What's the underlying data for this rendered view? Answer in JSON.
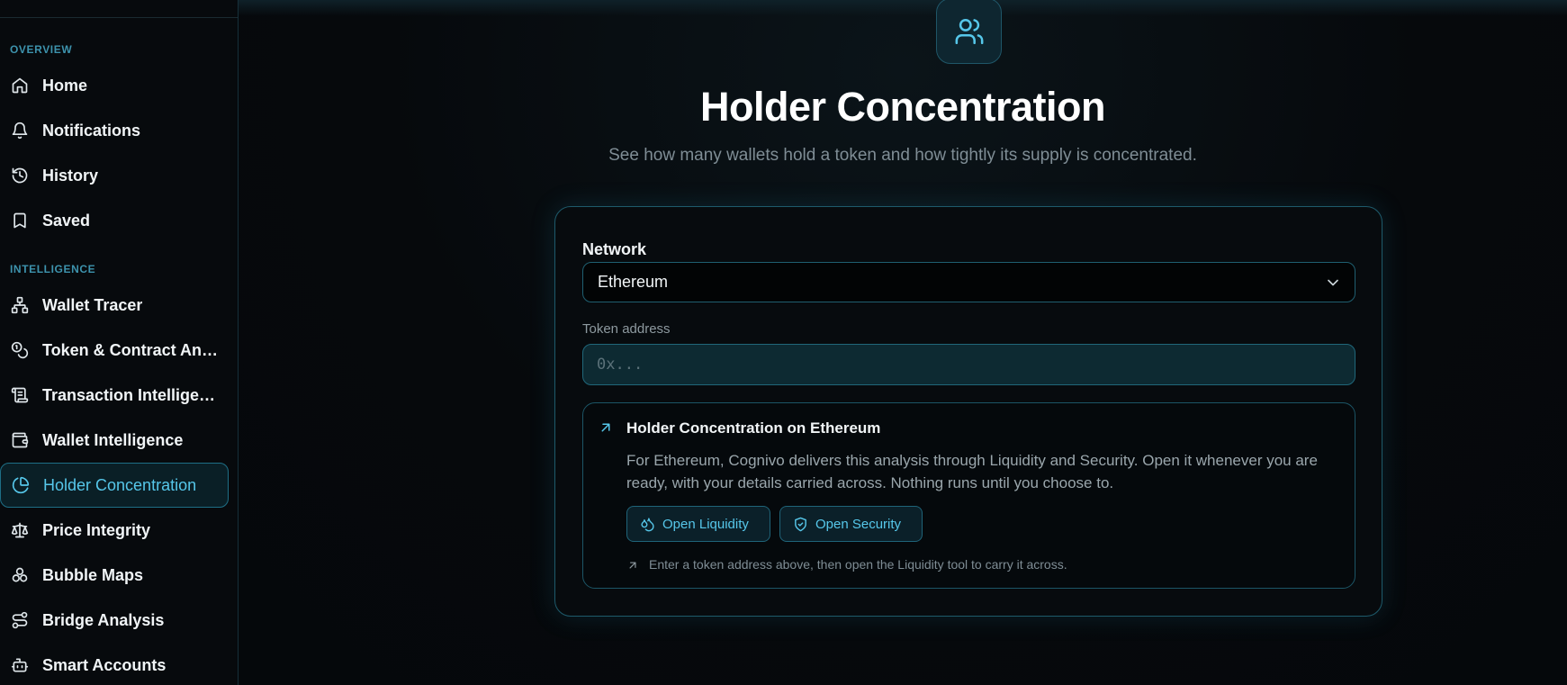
{
  "sidebar": {
    "sections": [
      {
        "label": "OVERVIEW"
      },
      {
        "label": "INTELLIGENCE"
      }
    ],
    "items": [
      {
        "label": "Home",
        "icon": "home-icon"
      },
      {
        "label": "Notifications",
        "icon": "bell-icon"
      },
      {
        "label": "History",
        "icon": "history-icon"
      },
      {
        "label": "Saved",
        "icon": "bookmark-icon"
      },
      {
        "label": "Wallet Tracer",
        "icon": "network-icon"
      },
      {
        "label": "Token & Contract Analysis",
        "icon": "coins-icon"
      },
      {
        "label": "Transaction Intelligence",
        "icon": "scroll-icon"
      },
      {
        "label": "Wallet Intelligence",
        "icon": "wallet-icon"
      },
      {
        "label": "Holder Concentration",
        "icon": "pie-chart-icon",
        "active": true
      },
      {
        "label": "Price Integrity",
        "icon": "scale-icon"
      },
      {
        "label": "Bubble Maps",
        "icon": "bubbles-icon"
      },
      {
        "label": "Bridge Analysis",
        "icon": "route-icon"
      },
      {
        "label": "Smart Accounts",
        "icon": "bot-icon"
      }
    ]
  },
  "main": {
    "hero_icon": "users-icon",
    "title": "Holder Concentration",
    "subtitle": "See how many wallets hold a token and how tightly its supply is concentrated.",
    "form": {
      "network_label": "Network",
      "network_value": "Ethereum",
      "token_label": "Token address",
      "token_placeholder": "0x...",
      "token_value": ""
    },
    "info": {
      "title": "Holder Concentration on Ethereum",
      "text": "For Ethereum, Cognivo delivers this analysis through Liquidity and Security. Open it whenever you are ready, with your details carried across. Nothing runs until you choose to.",
      "buttons": [
        {
          "label": "Open Liquidity",
          "icon": "droplets-icon"
        },
        {
          "label": "Open Security",
          "icon": "shield-check-icon"
        }
      ],
      "hint": "Enter a token address above, then open the Liquidity tool to carry it across."
    }
  },
  "colors": {
    "accent": "#56c7ea",
    "background": "#05080b",
    "border": "#1e5a6b"
  }
}
